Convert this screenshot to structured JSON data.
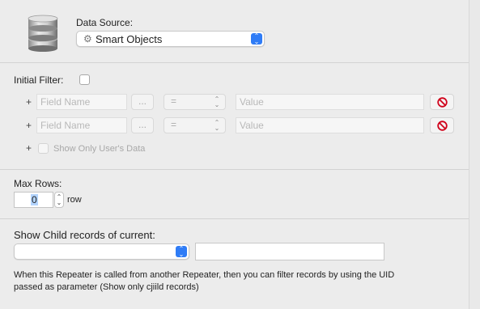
{
  "data_source": {
    "label": "Data Source:",
    "selected": "Smart Objects",
    "icon": "database-icon",
    "option_icon": "gear-icon"
  },
  "initial_filter": {
    "label": "Initial Filter:",
    "checked": false,
    "rows": [
      {
        "field_placeholder": "Field Name",
        "dots": "...",
        "operator": "=",
        "value_placeholder": "Value"
      },
      {
        "field_placeholder": "Field Name",
        "dots": "...",
        "operator": "=",
        "value_placeholder": "Value"
      }
    ],
    "plus": "+",
    "show_only_users_data": "Show Only User's Data"
  },
  "max_rows": {
    "label": "Max Rows:",
    "value": "0",
    "unit": "row"
  },
  "child_records": {
    "label": "Show Child records of current:",
    "selected": "",
    "text_value": ""
  },
  "note": "When this Repeater is called from another Repeater, then you can filter records by using the UID passed as parameter (Show only cjiild records)",
  "colors": {
    "accent": "#2f7cf6",
    "delete": "#d0021b",
    "background": "#ececec"
  }
}
